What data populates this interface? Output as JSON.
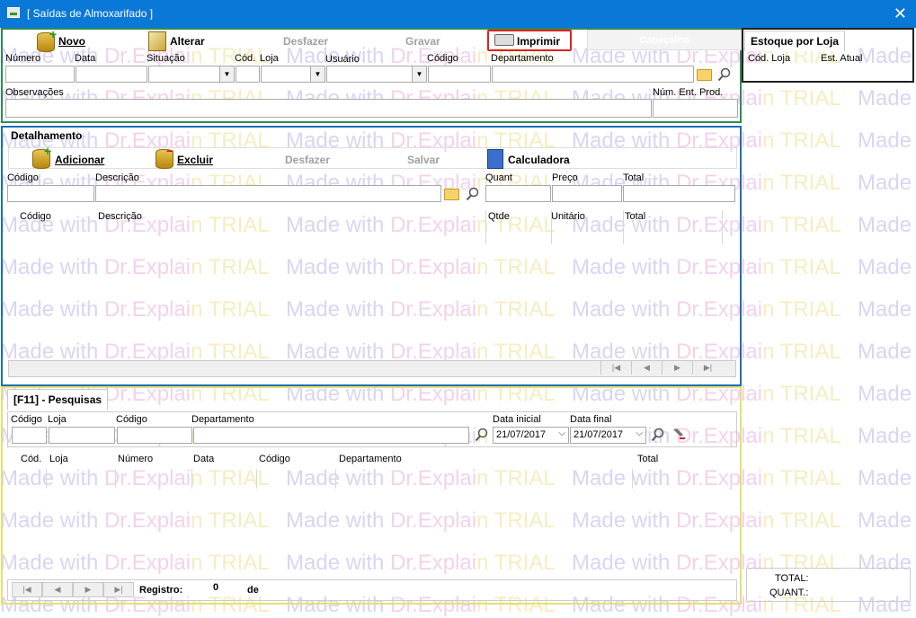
{
  "window": {
    "title": "[ Saídas de Almoxarifado ]",
    "close_glyph": "✕"
  },
  "toolbar": {
    "novo": "Novo",
    "alterar": "Alterar",
    "desfazer": "Desfazer",
    "gravar": "Gravar",
    "imprimir": "Imprimir",
    "cabecalho_tab": "Cabeçalho"
  },
  "header_fields": {
    "numero": "Número",
    "data": "Data",
    "situacao": "Situação",
    "cod": "Cód.",
    "loja": "Loja",
    "usuario": "Usuário",
    "codigo": "Código",
    "departamento": "Departamento",
    "observacoes": "Observações",
    "num_ent_prod": "Núm. Ent. Prod."
  },
  "detalhamento": {
    "title": "Detalhamento",
    "adicionar": "Adicionar",
    "excluir": "Excluir",
    "desfazer": "Desfazer",
    "salvar": "Salvar",
    "calculadora": "Calculadora",
    "codigo": "Código",
    "descricao": "Descrição",
    "quant": "Quant",
    "preco": "Preço",
    "total": "Total",
    "grid_headers": [
      "Código",
      "Descrição",
      "Qtde",
      "Unitário",
      "Total"
    ]
  },
  "pesquisas": {
    "tab": "[F11] - Pesquisas",
    "codigo": "Código",
    "loja": "Loja",
    "codigo2": "Código",
    "departamento": "Departamento",
    "data_inicial": "Data inicial",
    "data_final": "Data final",
    "data_inicial_value": "21/07/2017",
    "data_final_value": "21/07/2017",
    "grid_headers": [
      "Cód.",
      "Loja",
      "Número",
      "Data",
      "Código",
      "Departamento",
      "Total"
    ],
    "registro_label": "Registro:",
    "registro_value": "0",
    "de_label": "de"
  },
  "estoque": {
    "tab": "Estoque por Loja",
    "cod_loja": "Cód. Loja",
    "est_atual": "Est. Atual",
    "total_label": "TOTAL:",
    "quant_label": "QUANT.:"
  },
  "watermark_text": "Made with Dr.Explain TRIAL",
  "colors": {
    "titlebar": "#0a78d7",
    "header_border": "#2e8b57",
    "detail_border": "#1e6fb8",
    "search_border": "#e6e070",
    "imprimir_border": "#e02020"
  }
}
